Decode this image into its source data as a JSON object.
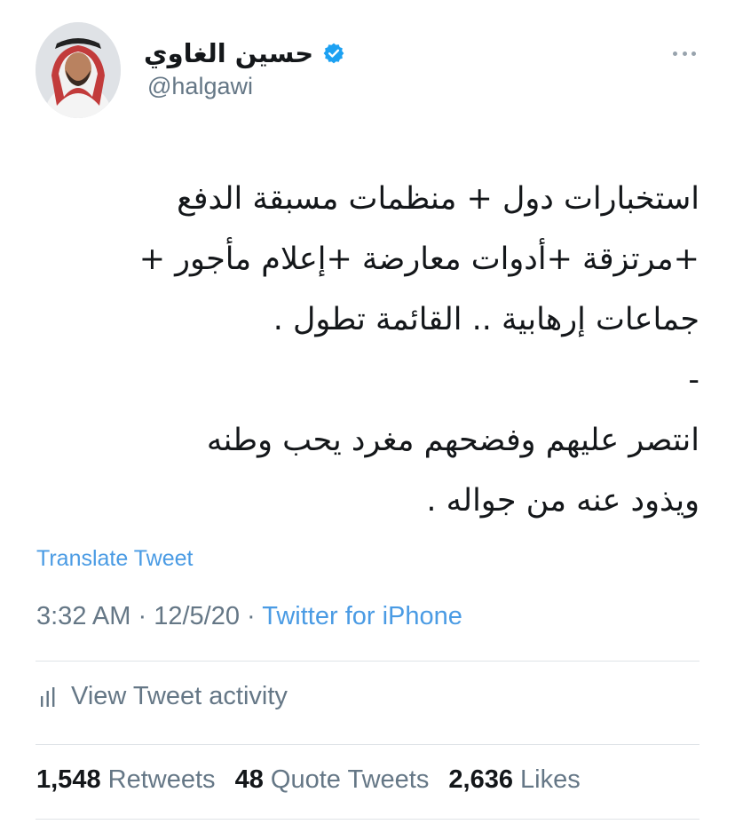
{
  "tweet": {
    "author": {
      "display_name": "حسين الغاوي",
      "handle": "@halgawi",
      "verified": true,
      "avatar_icon": "user-avatar"
    },
    "more_icon": "more-horizontal-icon",
    "body_lines": [
      "استخبارات دول + منظمات مسبقة الدفع",
      "+مرتزقة +أدوات معارضة +إعلام مأجور +",
      "جماعات إرهابية .. القائمة تطول .",
      "-",
      "انتصر عليهم وفضحهم مغرد يحب وطنه",
      "ويذود عنه من جواله ."
    ],
    "translate_label": "Translate Tweet",
    "time": "3:32 AM",
    "separator": "·",
    "date": "12/5/20",
    "source": "Twitter for iPhone",
    "activity_label": "View Tweet activity",
    "stats": {
      "retweets_count": "1,548",
      "retweets_label": "Retweets",
      "quotes_count": "48",
      "quotes_label": "Quote Tweets",
      "likes_count": "2,636",
      "likes_label": "Likes"
    },
    "colors": {
      "link": "#4a9be4",
      "secondary_text": "#657786",
      "verified_badge": "#1da1f2"
    }
  }
}
